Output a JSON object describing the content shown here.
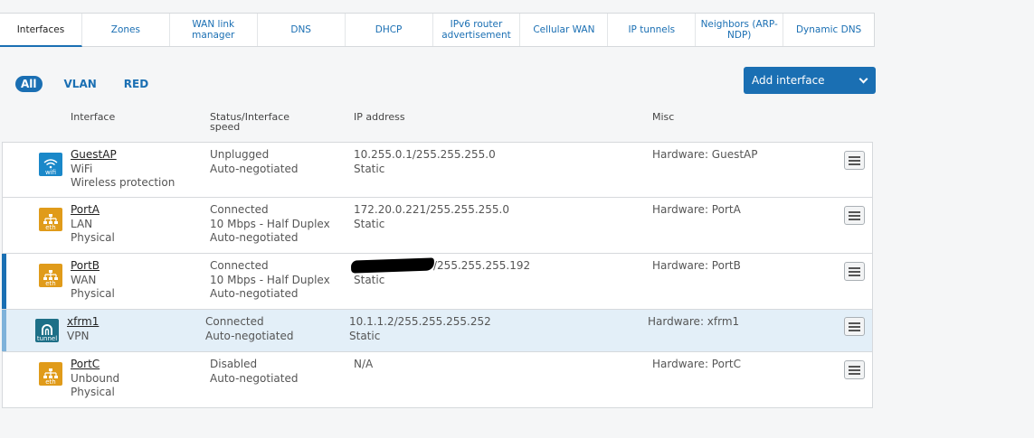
{
  "tabs": [
    "Interfaces",
    "Zones",
    "WAN link manager",
    "DNS",
    "DHCP",
    "IPv6 router advertisement",
    "Cellular WAN",
    "IP tunnels",
    "Neighbors (ARP-NDP)",
    "Dynamic DNS"
  ],
  "filters": [
    "All",
    "VLAN",
    "RED"
  ],
  "add_button": "Add interface",
  "columns": {
    "interface": "Interface",
    "status": "Status/Interface speed",
    "ip": "IP address",
    "misc": "Misc"
  },
  "rows": [
    {
      "name": "GuestAP",
      "icon": "wifi-icon",
      "icon_label": "wifi",
      "line2": "WiFi",
      "line3": "Wireless protection",
      "status1": "Unplugged",
      "status2": "Auto-negotiated",
      "status3": "",
      "ip": "10.255.0.1/255.255.255.0",
      "ip2": "Static",
      "misc": "Hardware:  GuestAP"
    },
    {
      "name": "PortA",
      "icon": "ethernet-icon",
      "icon_label": "eth",
      "line2": "LAN",
      "line3": "Physical",
      "status1": "Connected",
      "status2": "10 Mbps - Half Duplex",
      "status3": "Auto-negotiated",
      "ip": "172.20.0.221/255.255.255.0",
      "ip2": "Static",
      "misc": "Hardware:  PortA"
    },
    {
      "name": "PortB",
      "icon": "ethernet-icon",
      "icon_label": "eth",
      "line2": "WAN",
      "line3": "Physical",
      "status1": "Connected",
      "status2": "10 Mbps - Half Duplex",
      "status3": "Auto-negotiated",
      "ip": "/255.255.255.192",
      "ip2": "Static",
      "misc": "Hardware:  PortB"
    },
    {
      "name": "xfrm1",
      "icon": "tunnel-icon",
      "icon_label": "tunnel",
      "line2": "VPN",
      "line3": "",
      "status1": "Connected",
      "status2": "Auto-negotiated",
      "status3": "",
      "ip": "10.1.1.2/255.255.255.252",
      "ip2": "Static",
      "misc": "Hardware:  xfrm1"
    },
    {
      "name": "PortC",
      "icon": "ethernet-icon",
      "icon_label": "eth",
      "line2": "Unbound",
      "line3": "Physical",
      "status1": "Disabled",
      "status2": "Auto-negotiated",
      "status3": "",
      "ip": "N/A",
      "ip2": "",
      "misc": "Hardware:  PortC"
    }
  ],
  "colors": {
    "accent": "#1a6fb3",
    "selected_row": "#e3eff8",
    "eth_icon": "#e09b1a",
    "wifi_icon": "#1a88c9",
    "tunnel_icon": "#1d6f87"
  }
}
